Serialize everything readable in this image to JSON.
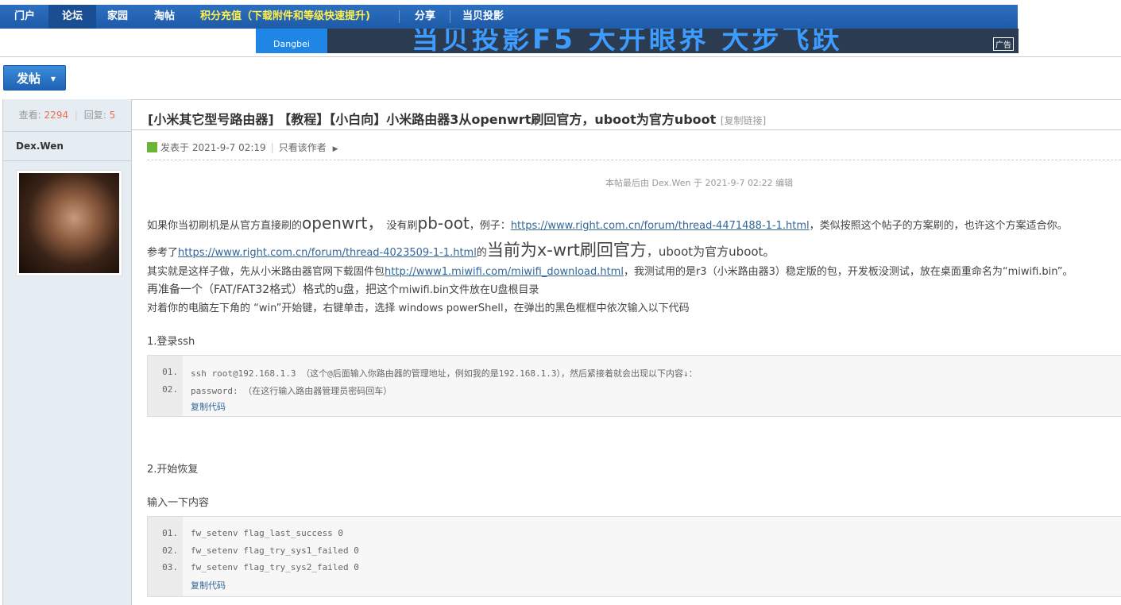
{
  "nav": {
    "items": [
      {
        "label": "门户"
      },
      {
        "label": "论坛"
      },
      {
        "label": "家园"
      },
      {
        "label": "淘帖"
      },
      {
        "label": "积分充值（下载附件和等级快速提升)"
      },
      {
        "label": "分享"
      },
      {
        "label": "当贝投影"
      }
    ]
  },
  "banner": {
    "brand": "Dangbei",
    "slogan": "当贝投影F5  大开眼界  大步飞跃",
    "badge": "广告"
  },
  "post_button": {
    "label": "发帖"
  },
  "stats": {
    "views_label": "查看:",
    "views": "2294",
    "replies_label": "回复:",
    "replies": "5"
  },
  "author": {
    "name": "Dex.Wen"
  },
  "thread": {
    "title": "[小米其它型号路由器] 【教程】【小白向】小米路由器3从openwrt刷回官方，uboot为官方uboot",
    "copy_link": "[复制链接]",
    "posted": "发表于 2021-9-7 02:19",
    "only_author": "只看该作者",
    "edited": "本帖最后由 Dex.Wen 于 2021-9-7 02:22 编辑"
  },
  "body": {
    "p1a": "如果你当初刷机是从官方直接刷的",
    "p1b": "openwrt，",
    "p1c": " 没有刷",
    "p1d": "pb-oot",
    "p1e": "，例子：",
    "p1link": "https://www.right.com.cn/forum/thread-4471488-1-1.html",
    "p1f": "，类似按照这个帖子的方案刷的，也许这个方案适合你。",
    "p2a": "参考了",
    "p2link": "https://www.right.com.cn/forum/thread-4023509-1-1.html",
    "p2b": "的",
    "p2c": "当前为x-wrt刷回官方",
    "p2d": "，uboot为官方uboot。",
    "p3a": "其实就是这样子做，先从小米路由器官网下载固件包",
    "p3link": "http://www1.miwifi.com/miwifi_download.html",
    "p3b": "，我测试用的是r3（小米路由器3）稳定版的包，开发板没测试，放在桌面重命名为“miwifi.bin”。",
    "p4a": "再准备一个（FAT/FAT32格式）格式的u盘，把这个",
    "p4b": "miwifi.bin文件放在U盘根目录",
    "p5": "对着你的电脑左下角的 “win”开始键，右键单击，选择 windows powerShell，在弹出的黑色框框中依次输入以下代码",
    "h1": "1.登录ssh",
    "h2": "2.开始恢复",
    "h3": "输入一下内容"
  },
  "code1": {
    "lines": [
      {
        "no": "01.",
        "text": "ssh root@192.168.1.3   （这个@后面输入你路由器的管理地址，例如我的是192.168.1.3），然后紧接着就会出现以下内容↓："
      },
      {
        "no": "02.",
        "text": "password:    （在这行输入路由器管理员密码回车）"
      }
    ],
    "copy": "复制代码"
  },
  "code2": {
    "lines": [
      {
        "no": "01.",
        "text": "fw_setenv flag_last_success 0"
      },
      {
        "no": "02.",
        "text": "fw_setenv flag_try_sys1_failed 0"
      },
      {
        "no": "03.",
        "text": "fw_setenv flag_try_sys2_failed 0"
      }
    ],
    "copy": "复制代码"
  }
}
